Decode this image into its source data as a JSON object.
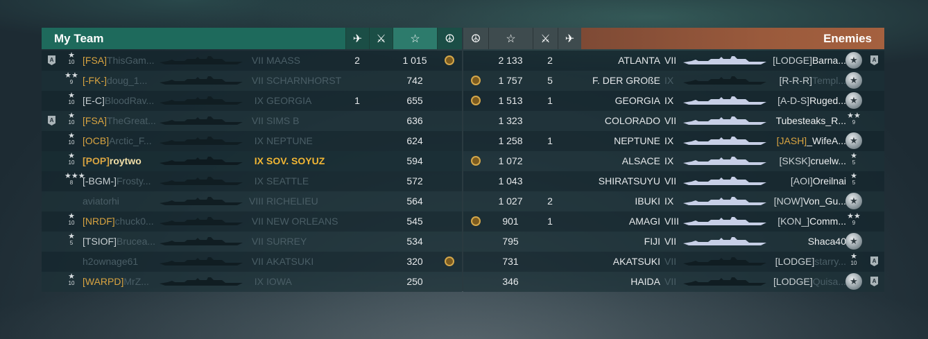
{
  "my_team": {
    "title": "My Team",
    "header_icons": [
      "plane-icon",
      "crossed-swords-icon",
      "star-icon",
      "laurel-icon"
    ],
    "rows": [
      {
        "badge": "A",
        "rank": "★",
        "rank_num": "10",
        "clan": "[FSA]",
        "name": "ThisGam...",
        "tier": "VII",
        "ship": "MAASS",
        "kills": "2",
        "xp": "1 015",
        "laurel": true,
        "alive": false,
        "clan_color": "orange"
      },
      {
        "badge": "",
        "rank": "★★",
        "rank_num": "9",
        "clan": "[-FK-]",
        "name": "doug_1...",
        "tier": "VII",
        "ship": "SCHARNHORST",
        "kills": "",
        "xp": "742",
        "laurel": false,
        "alive": false,
        "clan_color": "orange"
      },
      {
        "badge": "",
        "rank": "★",
        "rank_num": "10",
        "clan": "[E-C]",
        "name": "BloodRav...",
        "tier": "IX",
        "ship": "GEORGIA",
        "kills": "1",
        "xp": "655",
        "laurel": false,
        "alive": false,
        "clan_color": "white"
      },
      {
        "badge": "A",
        "rank": "★",
        "rank_num": "10",
        "clan": "[FSA]",
        "name": "TheGreat...",
        "tier": "VII",
        "ship": "SIMS B",
        "kills": "",
        "xp": "636",
        "laurel": false,
        "alive": false,
        "clan_color": "orange"
      },
      {
        "badge": "",
        "rank": "★",
        "rank_num": "10",
        "clan": "[OCB]",
        "name": "Arctic_F...",
        "tier": "IX",
        "ship": "NEPTUNE",
        "kills": "",
        "xp": "624",
        "laurel": false,
        "alive": false,
        "clan_color": "orange"
      },
      {
        "badge": "",
        "rank": "★",
        "rank_num": "10",
        "clan": "[POP]",
        "name": "roytwo",
        "tier": "IX",
        "ship": "SOV. SOYUZ",
        "kills": "",
        "xp": "594",
        "laurel": false,
        "alive": true,
        "clan_color": "orange"
      },
      {
        "badge": "",
        "rank": "★★★",
        "rank_num": "8",
        "clan": "[-BGM-]",
        "name": "Frosty...",
        "tier": "IX",
        "ship": "SEATTLE",
        "kills": "",
        "xp": "572",
        "laurel": false,
        "alive": false,
        "clan_color": "white"
      },
      {
        "badge": "",
        "rank": "",
        "rank_num": "",
        "clan": "",
        "name": "aviatorhi",
        "tier": "VIII",
        "ship": "RICHELIEU",
        "kills": "",
        "xp": "564",
        "laurel": false,
        "alive": false,
        "clan_color": "white"
      },
      {
        "badge": "",
        "rank": "★",
        "rank_num": "10",
        "clan": "[NRDF]",
        "name": "chuck0...",
        "tier": "VII",
        "ship": "NEW ORLEANS",
        "kills": "",
        "xp": "545",
        "laurel": false,
        "alive": false,
        "clan_color": "orange"
      },
      {
        "badge": "",
        "rank": "★",
        "rank_num": "5",
        "clan": "[TSIOF]",
        "name": "Brucea...",
        "tier": "VII",
        "ship": "SURREY",
        "kills": "",
        "xp": "534",
        "laurel": false,
        "alive": false,
        "clan_color": "white"
      },
      {
        "badge": "",
        "rank": "",
        "rank_num": "",
        "clan": "",
        "name": "h2ownage61",
        "tier": "VII",
        "ship": "AKATSUKI",
        "kills": "",
        "xp": "320",
        "laurel": true,
        "alive": false,
        "clan_color": "white"
      },
      {
        "badge": "",
        "rank": "★",
        "rank_num": "10",
        "clan": "[WARPD]",
        "name": "MrZ...",
        "tier": "IX",
        "ship": "IOWA",
        "kills": "",
        "xp": "250",
        "laurel": false,
        "alive": false,
        "clan_color": "orange"
      }
    ]
  },
  "enemies": {
    "title": "Enemies",
    "header_icons": [
      "laurel-icon",
      "star-icon",
      "crossed-swords-icon",
      "plane-icon"
    ],
    "rows": [
      {
        "laurel": false,
        "xp": "2 133",
        "kills": "2",
        "ship": "ATLANTA",
        "tier": "VII",
        "clan": "[LODGE]",
        "name": "Barna...",
        "medal": true,
        "rank_num": "",
        "badge": "A",
        "alive": true
      },
      {
        "laurel": true,
        "xp": "1 757",
        "kills": "5",
        "ship": "F. DER GROßE",
        "tier": "IX",
        "clan": "[R-R-R]",
        "name": "Templ...",
        "medal": true,
        "rank_num": "",
        "badge": "",
        "alive": false
      },
      {
        "laurel": true,
        "xp": "1 513",
        "kills": "1",
        "ship": "GEORGIA",
        "tier": "IX",
        "clan": "[A-D-S]",
        "name": "Ruged...",
        "medal": true,
        "rank_num": "",
        "badge": "",
        "alive": true
      },
      {
        "laurel": false,
        "xp": "1 323",
        "kills": "",
        "ship": "COLORADO",
        "tier": "VII",
        "clan": "",
        "name": "Tubesteaks_R...",
        "medal": false,
        "rank": "★★",
        "rank_num": "9",
        "badge": "",
        "alive": true
      },
      {
        "laurel": false,
        "xp": "1 258",
        "kills": "1",
        "ship": "NEPTUNE",
        "tier": "IX",
        "clan": "[JASH]",
        "name": "_WifeA...",
        "medal": true,
        "rank_num": "",
        "badge": "",
        "alive": true,
        "clan_orange": true
      },
      {
        "laurel": true,
        "xp": "1 072",
        "kills": "",
        "ship": "ALSACE",
        "tier": "IX",
        "clan": "[SKSK]",
        "name": "cruelw...",
        "medal": false,
        "rank": "★",
        "rank_num": "5",
        "badge": "",
        "alive": true
      },
      {
        "laurel": false,
        "xp": "1 043",
        "kills": "",
        "ship": "SHIRATSUYU",
        "tier": "VII",
        "clan": "[AOI]",
        "name": "Oreilnai",
        "medal": false,
        "rank": "★",
        "rank_num": "5",
        "badge": "",
        "alive": true
      },
      {
        "laurel": false,
        "xp": "1 027",
        "kills": "2",
        "ship": "IBUKI",
        "tier": "IX",
        "clan": "[NOW]",
        "name": "Von_Gu...",
        "medal": true,
        "rank_num": "",
        "badge": "",
        "alive": true
      },
      {
        "laurel": true,
        "xp": "901",
        "kills": "1",
        "ship": "AMAGI",
        "tier": "VIII",
        "clan": "[KON_]",
        "name": "Comm...",
        "medal": false,
        "rank": "★★",
        "rank_num": "9",
        "badge": "",
        "alive": true
      },
      {
        "laurel": false,
        "xp": "795",
        "kills": "",
        "ship": "FIJI",
        "tier": "VII",
        "clan": "",
        "name": "Shaca40",
        "medal": true,
        "rank_num": "",
        "badge": "",
        "alive": true
      },
      {
        "laurel": false,
        "xp": "731",
        "kills": "",
        "ship": "AKATSUKI",
        "tier": "VII",
        "clan": "[LODGE]",
        "name": "starry...",
        "medal": false,
        "rank": "★",
        "rank_num": "10",
        "badge": "A",
        "alive": false
      },
      {
        "laurel": false,
        "xp": "346",
        "kills": "",
        "ship": "HAIDA",
        "tier": "VII",
        "clan": "[LODGE]",
        "name": "Quisa...",
        "medal": true,
        "rank_num": "",
        "badge": "A",
        "alive": false
      }
    ]
  },
  "colors": {
    "team_header": "#1e6a5c",
    "enemy_header": "#9a5a3c",
    "clan_orange": "#d9a441",
    "highlight_gold": "#f1b634"
  }
}
